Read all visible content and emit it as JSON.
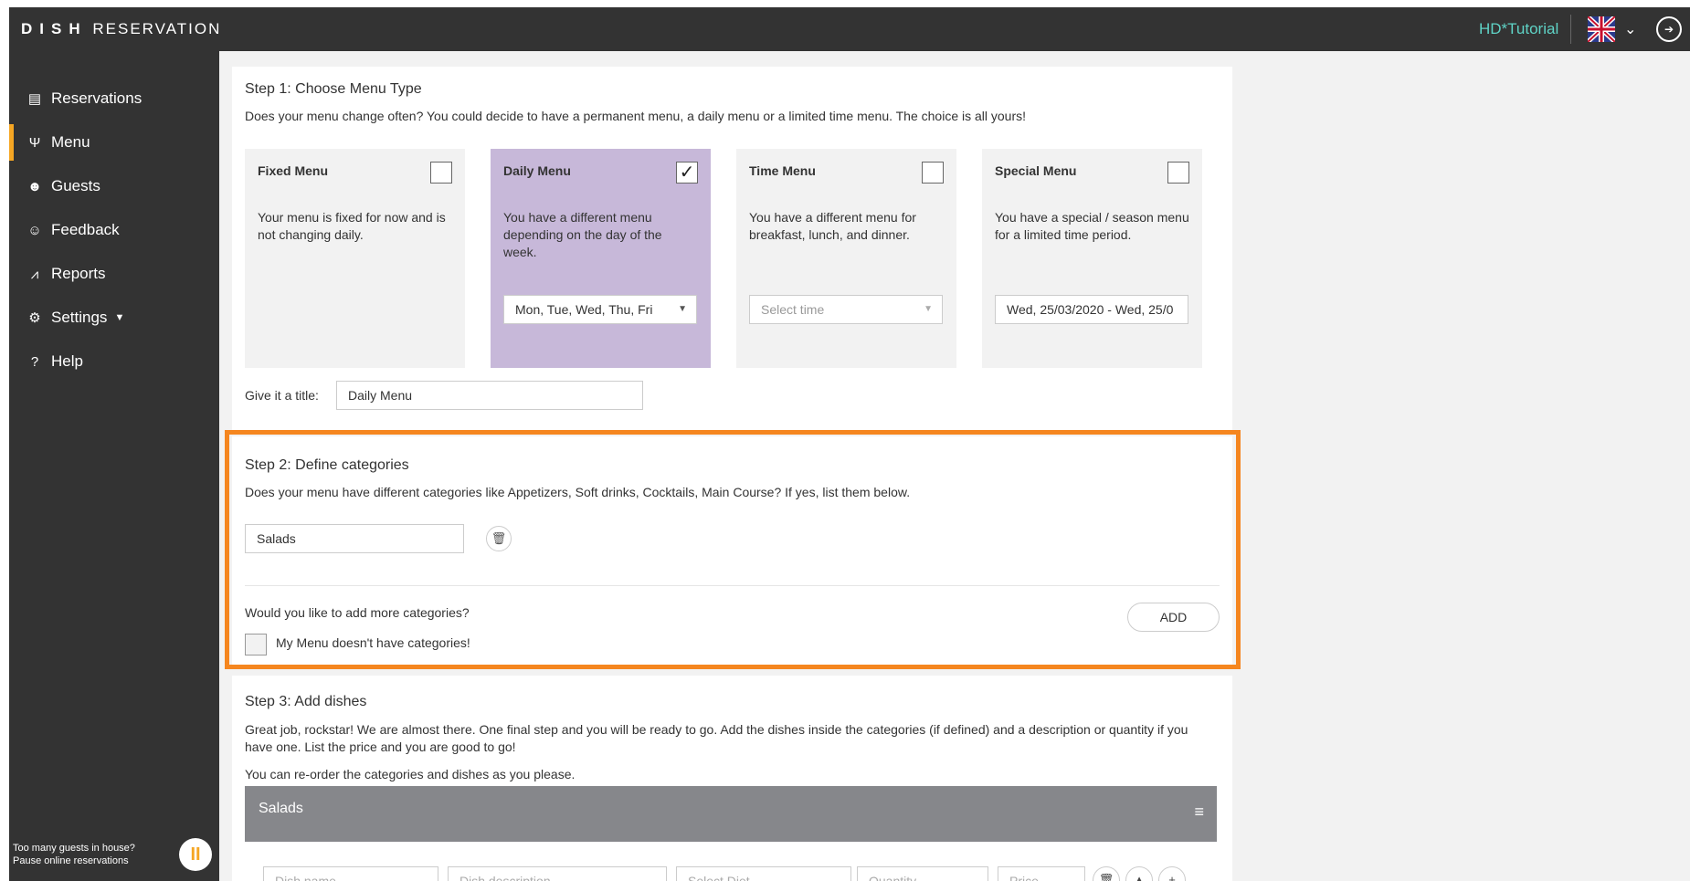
{
  "topbar": {
    "logo_dish": "DISH",
    "logo_reservation": "RESERVATION",
    "tutorial": "HD*Tutorial",
    "language_icon": "uk-flag-icon",
    "chevron_icon": "chevron-down-icon",
    "logout_icon": "logout-icon"
  },
  "sidebar": {
    "items": [
      {
        "label": "Reservations",
        "icon": "book-icon"
      },
      {
        "label": "Menu",
        "icon": "fork-knife-icon"
      },
      {
        "label": "Guests",
        "icon": "users-icon"
      },
      {
        "label": "Feedback",
        "icon": "smiley-icon"
      },
      {
        "label": "Reports",
        "icon": "chart-icon"
      },
      {
        "label": "Settings",
        "icon": "gear-icon"
      },
      {
        "label": "Help",
        "icon": "help-icon"
      }
    ],
    "pause_text_line1": "Too many guests in house?",
    "pause_text_line2": "Pause online reservations"
  },
  "step1": {
    "title": "Step 1: Choose Menu Type",
    "description": "Does your menu change often? You could decide to have a permanent menu, a daily menu or a limited time menu. The choice is all yours!",
    "types": [
      {
        "title": "Fixed Menu",
        "desc": "Your menu is fixed for now and is not changing daily.",
        "checked": false
      },
      {
        "title": "Daily Menu",
        "desc": "You have a different menu depending on the day of the week.",
        "checked": true,
        "select": "Mon, Tue, Wed, Thu, Fri"
      },
      {
        "title": "Time Menu",
        "desc": "You have a different menu for breakfast, lunch, and dinner.",
        "checked": false,
        "select_placeholder": "Select time"
      },
      {
        "title": "Special Menu",
        "desc": "You have a special / season menu for a limited time period.",
        "checked": false,
        "select": "Wed, 25/03/2020 - Wed, 25/0"
      }
    ],
    "check_mark": "✓",
    "title_label": "Give it a title:",
    "title_value": "Daily Menu"
  },
  "step2": {
    "title": "Step 2: Define categories",
    "description": "Does your menu have different categories like Appetizers, Soft drinks, Cocktails, Main Course? If yes, list them below.",
    "category_value": "Salads",
    "more_question": "Would you like to add more categories?",
    "add_label": "ADD",
    "no_categories_label": "My Menu doesn't have categories!"
  },
  "step3": {
    "title": "Step 3: Add dishes",
    "description1": "Great job, rockstar! We are almost there. One final step and you will be ready to go. Add the dishes inside the categories (if defined) and a description or quantity if you have one. List the price and you are good to go!",
    "description2": "You can re-order the categories and dishes as you please.",
    "category_name": "Salads",
    "dish_name_placeholder": "Dish name",
    "dish_desc_placeholder": "Dish description",
    "diet_placeholder": "Select Diet",
    "quantity_placeholder": "Quantity",
    "price_placeholder": "Price"
  },
  "colors": {
    "dark": "#333333",
    "accent": "#f5a623",
    "highlight": "#f5861f",
    "selected": "#c7b8d9",
    "teal": "#5fd3c6"
  }
}
